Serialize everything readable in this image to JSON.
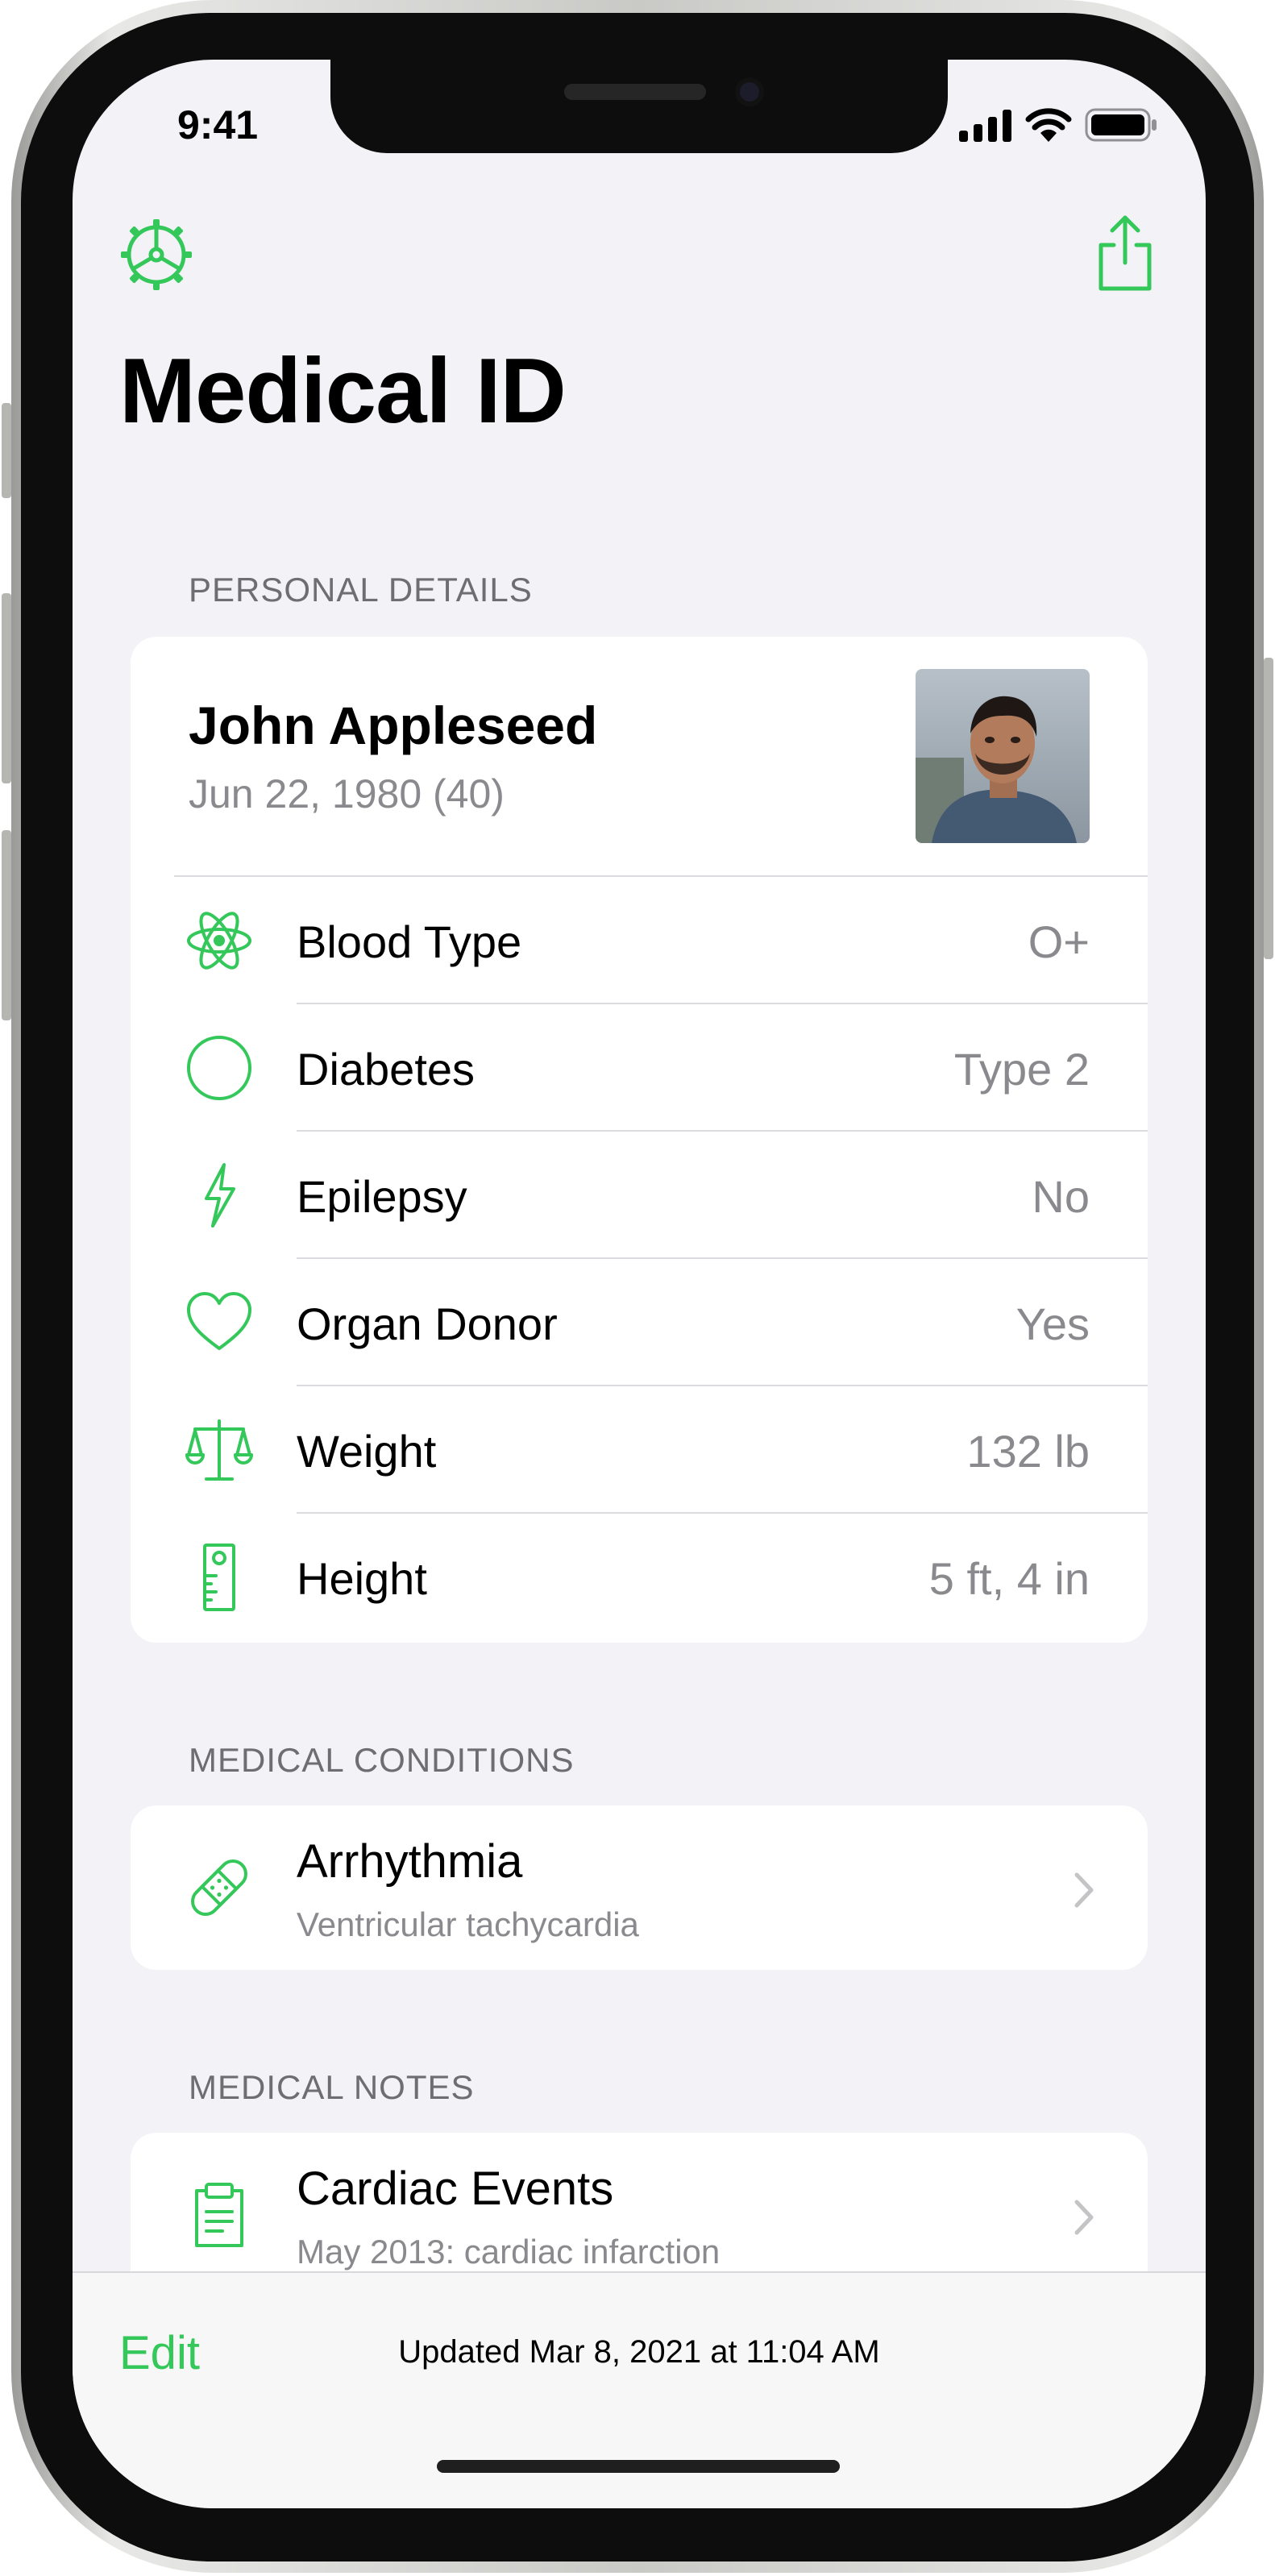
{
  "status_bar": {
    "time": "9:41"
  },
  "nav": {
    "title": "Medical ID"
  },
  "personal": {
    "header": "PERSONAL DETAILS",
    "name": "John Appleseed",
    "dob": "Jun 22, 1980 (40)",
    "rows": [
      {
        "icon": "atom-icon",
        "label": "Blood Type",
        "value": "O+"
      },
      {
        "icon": "circle-icon",
        "label": "Diabetes",
        "value": "Type 2"
      },
      {
        "icon": "lightning-icon",
        "label": "Epilepsy",
        "value": "No"
      },
      {
        "icon": "heart-icon",
        "label": "Organ Donor",
        "value": "Yes"
      },
      {
        "icon": "scale-icon",
        "label": "Weight",
        "value": "132 lb"
      },
      {
        "icon": "ruler-icon",
        "label": "Height",
        "value": "5 ft, 4 in"
      }
    ]
  },
  "conditions": {
    "header": "MEDICAL CONDITIONS",
    "items": [
      {
        "icon": "bandage-icon",
        "title": "Arrhythmia",
        "subtitle": "Ventricular tachycardia"
      }
    ]
  },
  "notes": {
    "header": "MEDICAL NOTES",
    "items": [
      {
        "icon": "clipboard-icon",
        "title": "Cardiac Events",
        "subtitle": "May 2013: cardiac infarction"
      }
    ]
  },
  "toolbar": {
    "edit_label": "Edit",
    "updated_text": "Updated Mar 8, 2021 at 11:04 AM"
  },
  "colors": {
    "accent": "#34c759",
    "background": "#f2f2f7",
    "secondary_text": "#8a8a8e"
  }
}
